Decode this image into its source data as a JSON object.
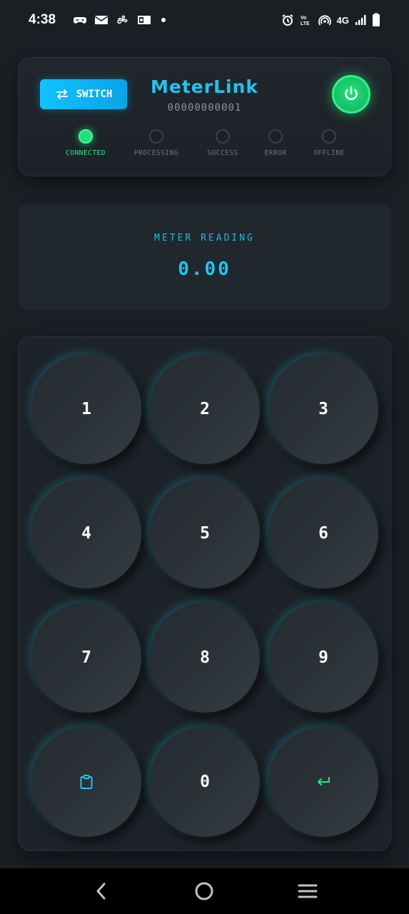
{
  "status_bar": {
    "time": "4:38",
    "network": "4G",
    "volte": "Vo))\nLTE"
  },
  "header": {
    "switch_label": "SWITCH",
    "brand": "MeterLink",
    "meter_id": "00000000001",
    "power_icon": "power-icon",
    "accent_color": "#22c4ee",
    "online_color": "#1fe07a"
  },
  "indicators": [
    {
      "label": "CONNECTED",
      "active": true
    },
    {
      "label": "PROCESSING",
      "active": false
    },
    {
      "label": "SUCCESS",
      "active": false
    },
    {
      "label": "ERROR",
      "active": false
    },
    {
      "label": "OFFLINE",
      "active": false
    }
  ],
  "reading": {
    "label": "METER READING",
    "value": "0.00"
  },
  "keypad": {
    "keys": [
      "1",
      "2",
      "3",
      "4",
      "5",
      "6",
      "7",
      "8",
      "9",
      "clipboard-icon",
      "0",
      "enter-icon"
    ]
  },
  "nav": {
    "back_icon": "back-icon",
    "home_icon": "home-icon",
    "menu_icon": "menu-icon"
  }
}
